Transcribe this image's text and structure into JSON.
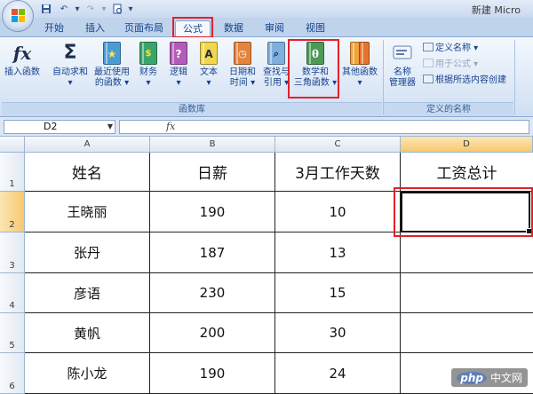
{
  "window": {
    "title": "新建 Micro"
  },
  "tabs": [
    {
      "label": "开始"
    },
    {
      "label": "插入"
    },
    {
      "label": "页面布局"
    },
    {
      "label": "公式"
    },
    {
      "label": "数据"
    },
    {
      "label": "审阅"
    },
    {
      "label": "视图"
    }
  ],
  "ribbon": {
    "function_library": {
      "group_label": "函数库",
      "insert_function": {
        "icon": "fx",
        "label": "插入函数"
      },
      "auto_sum": {
        "icon": "Σ",
        "label_line1": "自动求和",
        "label_line2": ""
      },
      "recent": {
        "label_line1": "最近使用",
        "label_line2": "的函数"
      },
      "financial": {
        "label_line1": "财务",
        "label_line2": ""
      },
      "logical": {
        "icon": "?",
        "label_line1": "逻辑",
        "label_line2": ""
      },
      "text": {
        "icon": "A",
        "label_line1": "文本",
        "label_line2": ""
      },
      "datetime": {
        "label_line1": "日期和",
        "label_line2": "时间"
      },
      "lookup": {
        "label_line1": "查找与",
        "label_line2": "引用"
      },
      "math_trig": {
        "icon": "θ",
        "label_line1": "数学和",
        "label_line2": "三角函数"
      },
      "other": {
        "label_line1": "其他函数",
        "label_line2": ""
      }
    },
    "defined_names": {
      "group_label": "定义的名称",
      "name_manager": {
        "label_line1": "名称",
        "label_line2": "管理器"
      },
      "define_name": "定义名称",
      "use_in_formula": "用于公式",
      "create_from_selection": "根据所选内容创建"
    }
  },
  "formula_bar": {
    "name_box": "D2",
    "fx_label": "fx",
    "content": ""
  },
  "sheet": {
    "columns": [
      "A",
      "B",
      "C",
      "D"
    ],
    "rows": [
      "1",
      "2",
      "3",
      "4",
      "5",
      "6"
    ],
    "headers": [
      "姓名",
      "日薪",
      "3月工作天数",
      "工资总计"
    ],
    "data": [
      [
        "王晓丽",
        "190",
        "10",
        ""
      ],
      [
        "张丹",
        "187",
        "13",
        ""
      ],
      [
        "彦语",
        "230",
        "15",
        ""
      ],
      [
        "黄帆",
        "200",
        "30",
        ""
      ],
      [
        "陈小龙",
        "190",
        "24",
        ""
      ]
    ]
  },
  "watermark": {
    "logo": "php",
    "text": "中文网"
  },
  "colors": {
    "highlight": "#e3202a",
    "selected_header": "#f7c870"
  }
}
